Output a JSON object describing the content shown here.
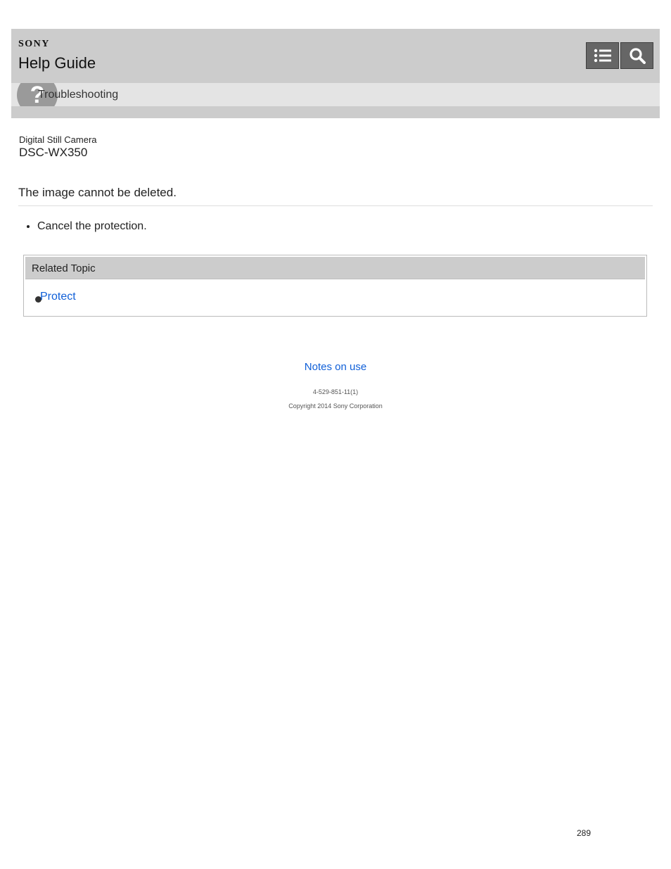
{
  "header": {
    "brand": "SONY",
    "title": "Help Guide",
    "toc_icon": "list-icon",
    "search_icon": "search-icon"
  },
  "category": {
    "icon": "question-icon",
    "icon_glyph": "?",
    "label": "Troubleshooting"
  },
  "product": {
    "type": "Digital Still Camera",
    "model": "DSC-WX350"
  },
  "article": {
    "title": "The image cannot be deleted.",
    "steps": [
      "Cancel the protection."
    ]
  },
  "related": {
    "title": "Related Topic",
    "items": [
      "Protect"
    ]
  },
  "footer": {
    "notes_link": "Notes on use",
    "code": "4-529-851-11(1)",
    "copyright": "Copyright 2014 Sony Corporation"
  },
  "page_number": "289",
  "colors": {
    "header_bg": "#cccccc",
    "category_bg": "#e4e4e4",
    "button_bg": "#666666",
    "link": "#0f5fd8"
  }
}
